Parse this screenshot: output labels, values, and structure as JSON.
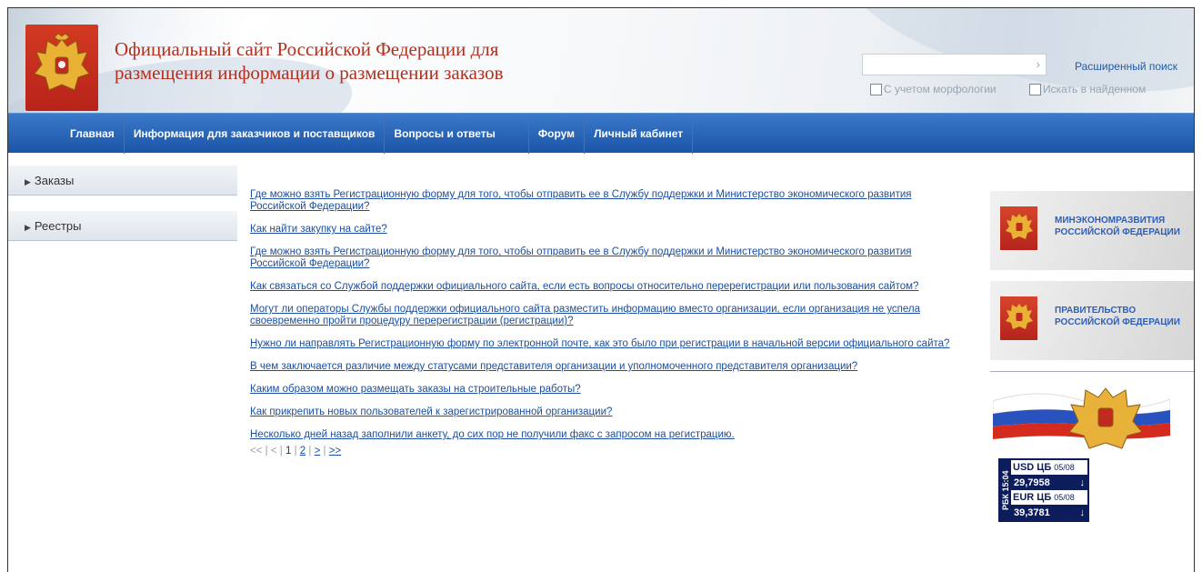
{
  "header": {
    "title_line1": "Официальный сайт Российской Федерации для",
    "title_line2": "размещения информации о размещении заказов",
    "search_arrow": "›",
    "advanced_search": "Расширенный поиск",
    "checkbox_morphology": "С учетом морфологии",
    "checkbox_in_found": "Искать в найденном"
  },
  "nav": {
    "items": [
      {
        "label": "Главная"
      },
      {
        "label": "Информация для заказчиков и поставщиков"
      },
      {
        "label": "Вопросы и ответы"
      },
      {
        "label": "Форум"
      },
      {
        "label": "Личный кабинет"
      }
    ]
  },
  "sidebar": {
    "items": [
      {
        "label": "Заказы"
      },
      {
        "label": "Реестры"
      }
    ]
  },
  "questions": [
    {
      "text": "Где можно взять Регистрационную форму для того, чтобы отправить ее в Службу поддержки и Министерство экономического развития Российской Федерации?"
    },
    {
      "text": "Как найти закупку на сайте?"
    },
    {
      "text": "Где можно взять Регистрационную форму для того, чтобы отправить ее в Службу поддержки и Министерство экономического развития Российской Федерации?"
    },
    {
      "text": "Как связаться со Службой поддержки официального сайта, если есть вопросы относительно перерегистрации или пользования сайтом?"
    },
    {
      "text": "Могут ли операторы Службы поддержки официального сайта разместить информацию вместо организации, если организация не успела своевременно пройти процедуру перерегистрации (регистрации)?"
    },
    {
      "text": "Нужно ли направлять Регистрационную форму по электронной почте, как это было при регистрации в начальной версии официального сайта?"
    },
    {
      "text": "В чем заключается различие между статусами представителя организации и уполномоченного представителя организации?"
    },
    {
      "text": "Каким образом можно размещать заказы на строительные работы?"
    },
    {
      "text": "Как прикрепить новых пользователей к зарегистрированной организации?"
    },
    {
      "text": "Несколько дней назад заполнили анкету, до сих пор не получили факс с запросом на регистрацию."
    }
  ],
  "pager": {
    "first": "<<",
    "sep": "|",
    "prev": "<",
    "current": "1",
    "page2": "2",
    "next": ">",
    "last": ">>"
  },
  "banners": {
    "ministry_line1": "МИНЭКОНОМРАЗВИТИЯ",
    "ministry_line2": "РОССИЙСКОЙ ФЕДЕРАЦИИ",
    "government_line1": "ПРАВИТЕЛЬСТВО",
    "government_line2": "РОССИЙСКОЙ ФЕДЕРАЦИИ"
  },
  "rates": {
    "side_label": "РБК 15:04",
    "usd_label": "USD ЦБ",
    "usd_date": "05/08",
    "usd_value": "29,7958",
    "eur_label": "EUR ЦБ",
    "eur_date": "05/08",
    "eur_value": "39,3781",
    "arrow": "↓"
  },
  "colors": {
    "nav_blue": "#1b55a8",
    "title_red": "#b3301e",
    "link_blue": "#1c4fa0",
    "rbc_navy": "#0d1c5a"
  }
}
